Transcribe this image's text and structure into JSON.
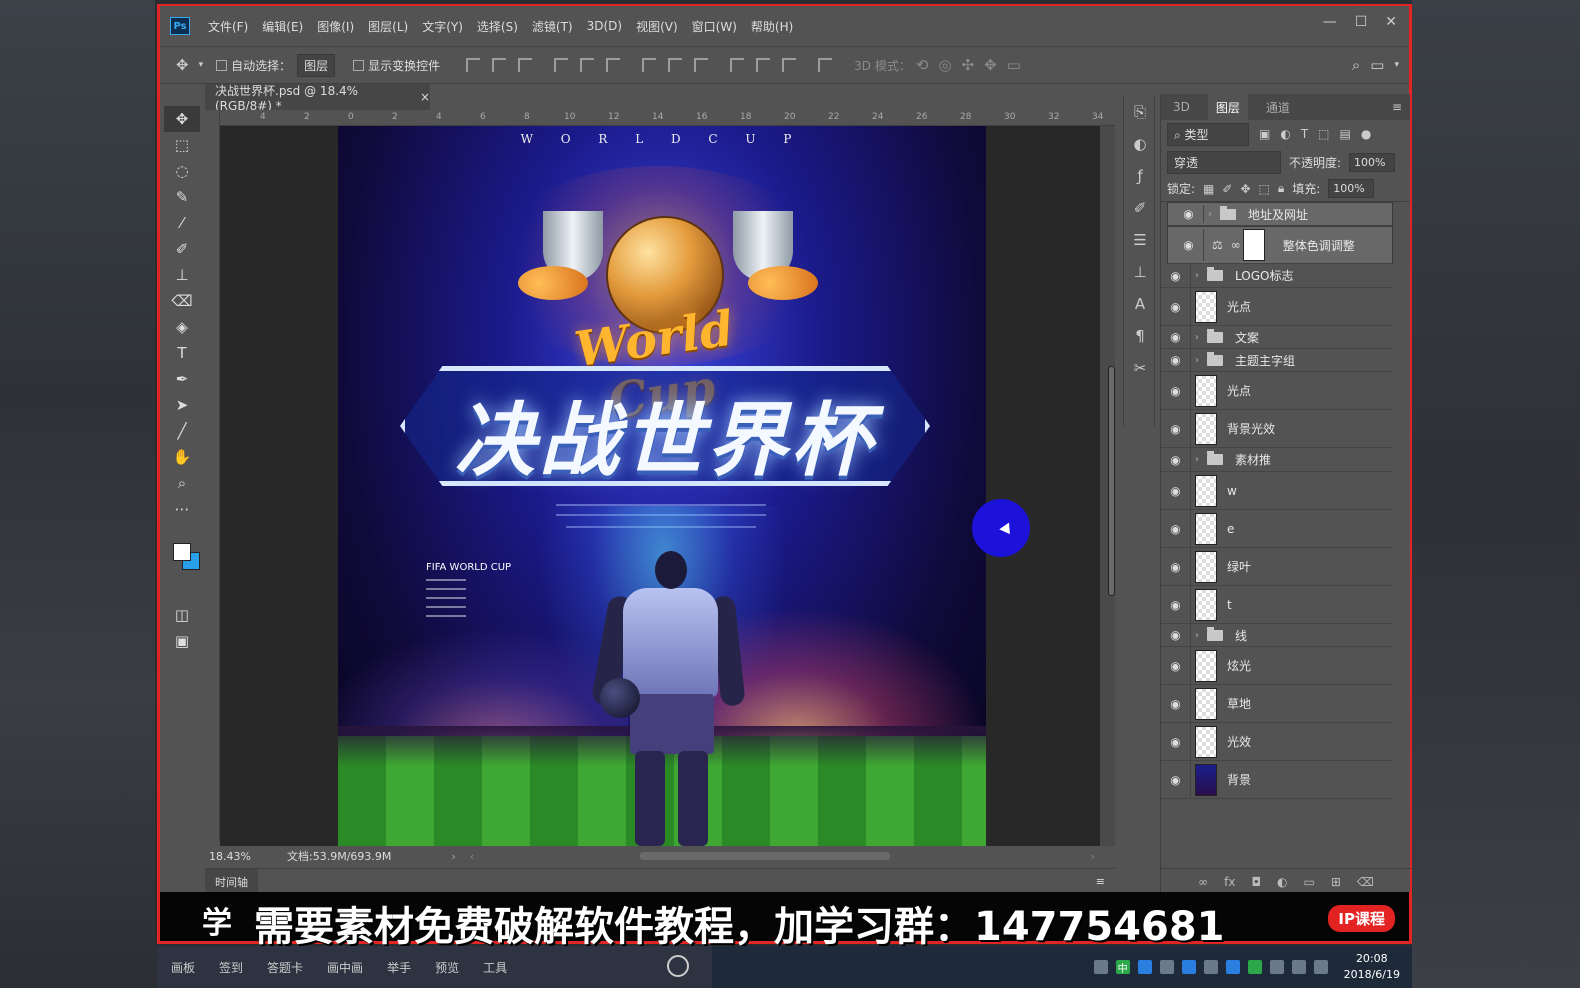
{
  "app": {
    "logo": "Ps",
    "menu": [
      "文件(F)",
      "编辑(E)",
      "图像(I)",
      "图层(L)",
      "文字(Y)",
      "选择(S)",
      "滤镜(T)",
      "3D(D)",
      "视图(V)",
      "窗口(W)",
      "帮助(H)"
    ],
    "window_controls": [
      "—",
      "☐",
      "✕"
    ]
  },
  "options_bar": {
    "auto_select_label": "自动选择：",
    "auto_select_value": "图层",
    "show_transform_label": "显示变换控件",
    "mode_3d_label": "3D 模式："
  },
  "document": {
    "tab_title": "决战世界杯.psd @ 18.4%(RGB/8#) *",
    "tab_close": "×",
    "ruler_ticks": [
      "4",
      "2",
      "0",
      "2",
      "4",
      "6",
      "8",
      "10",
      "12",
      "14",
      "16",
      "18",
      "20",
      "22",
      "24",
      "26",
      "28",
      "30",
      "32",
      "34"
    ],
    "zoom": "18.43%",
    "doc_size": "文档:53.9M/693.9M",
    "timeline_label": "时间轴"
  },
  "poster": {
    "top_letters": "W O R L D C U P",
    "script_title": "World Cup",
    "main_title": "决战世界杯",
    "fifa_label": "FIFA WORLD CUP"
  },
  "layers_panel": {
    "tabs": [
      "3D",
      "图层",
      "通道"
    ],
    "active_tab": "图层",
    "filter_kind": "类型",
    "blend_mode": "穿透",
    "opacity_label": "不透明度:",
    "opacity_value": "100%",
    "lock_label": "锁定:",
    "fill_label": "填充:",
    "fill_value": "100%",
    "layers": [
      {
        "name": "地址及网址",
        "kind": "group",
        "selected": true
      },
      {
        "name": "整体色调调整",
        "kind": "adjustment",
        "selected": true
      },
      {
        "name": "LOGO标志",
        "kind": "group",
        "selected": false
      },
      {
        "name": "光点",
        "kind": "layer",
        "selected": false
      },
      {
        "name": "文案",
        "kind": "group",
        "selected": false
      },
      {
        "name": "主题主字组",
        "kind": "group",
        "selected": false
      },
      {
        "name": "光点",
        "kind": "layer",
        "selected": false
      },
      {
        "name": "背景光效",
        "kind": "layer",
        "selected": false
      },
      {
        "name": "素材推",
        "kind": "group",
        "selected": false
      },
      {
        "name": "w",
        "kind": "layer",
        "selected": false
      },
      {
        "name": "e",
        "kind": "layer",
        "selected": false
      },
      {
        "name": "绿叶",
        "kind": "layer",
        "selected": false
      },
      {
        "name": "t",
        "kind": "layer",
        "selected": false
      },
      {
        "name": "线",
        "kind": "group",
        "selected": false
      },
      {
        "name": "炫光",
        "kind": "layer",
        "selected": false
      },
      {
        "name": "草地",
        "kind": "layer",
        "selected": false
      },
      {
        "name": "光效",
        "kind": "layer",
        "selected": false
      },
      {
        "name": "背景",
        "kind": "background",
        "selected": false
      }
    ],
    "footer_icons": [
      "link-icon",
      "fx-icon",
      "mask-icon",
      "adjustment-icon",
      "folder-icon",
      "new-layer-icon",
      "trash-icon"
    ]
  },
  "banner": {
    "left_text": "学",
    "text": "需要素材免费破解软件教程，加学习群：147754681",
    "badge": "IP课程"
  },
  "taskbar": {
    "items": [
      "画板",
      "签到",
      "答题卡",
      "画中画",
      "举手",
      "预览",
      "工具"
    ],
    "time": "20:08",
    "date": "2018/6/19",
    "ime": "中"
  },
  "colors": {
    "accent_border": "#e22424",
    "fg_swatch": "#ffffff",
    "bg_swatch": "#2aa0e8",
    "cursor_highlight": "#1c12d9"
  }
}
